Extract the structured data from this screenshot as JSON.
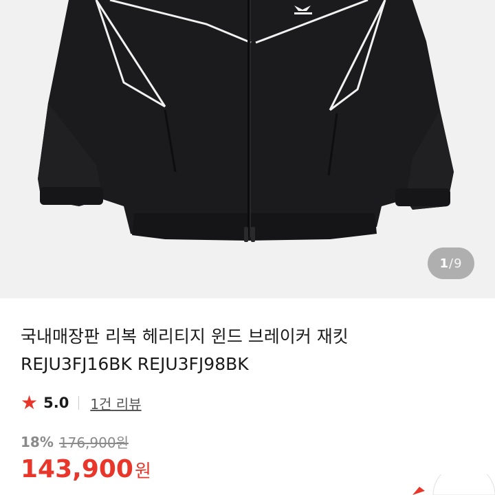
{
  "gallery": {
    "image_alt": "Reebok heritage wind breaker jacket, black with white piping",
    "pager": {
      "current": "1",
      "separator": "/",
      "total": "9"
    }
  },
  "product": {
    "title_line1": "국내매장판 리복 헤리티지 윈드 브레이커 재킷",
    "title_line2": "REJU3FJ16BK REJU3FJ98BK",
    "rating": {
      "score": "5.0",
      "reviews_label": "1건 리뷰"
    },
    "discount_rate": "18%",
    "original_price": "176,900원",
    "sale_price": "143,900",
    "sale_currency": "원"
  },
  "colors": {
    "accent": "#e8362b",
    "jacket": "#1b1b1d",
    "piping": "#f2f2f2",
    "background": "#f1f1f1"
  }
}
